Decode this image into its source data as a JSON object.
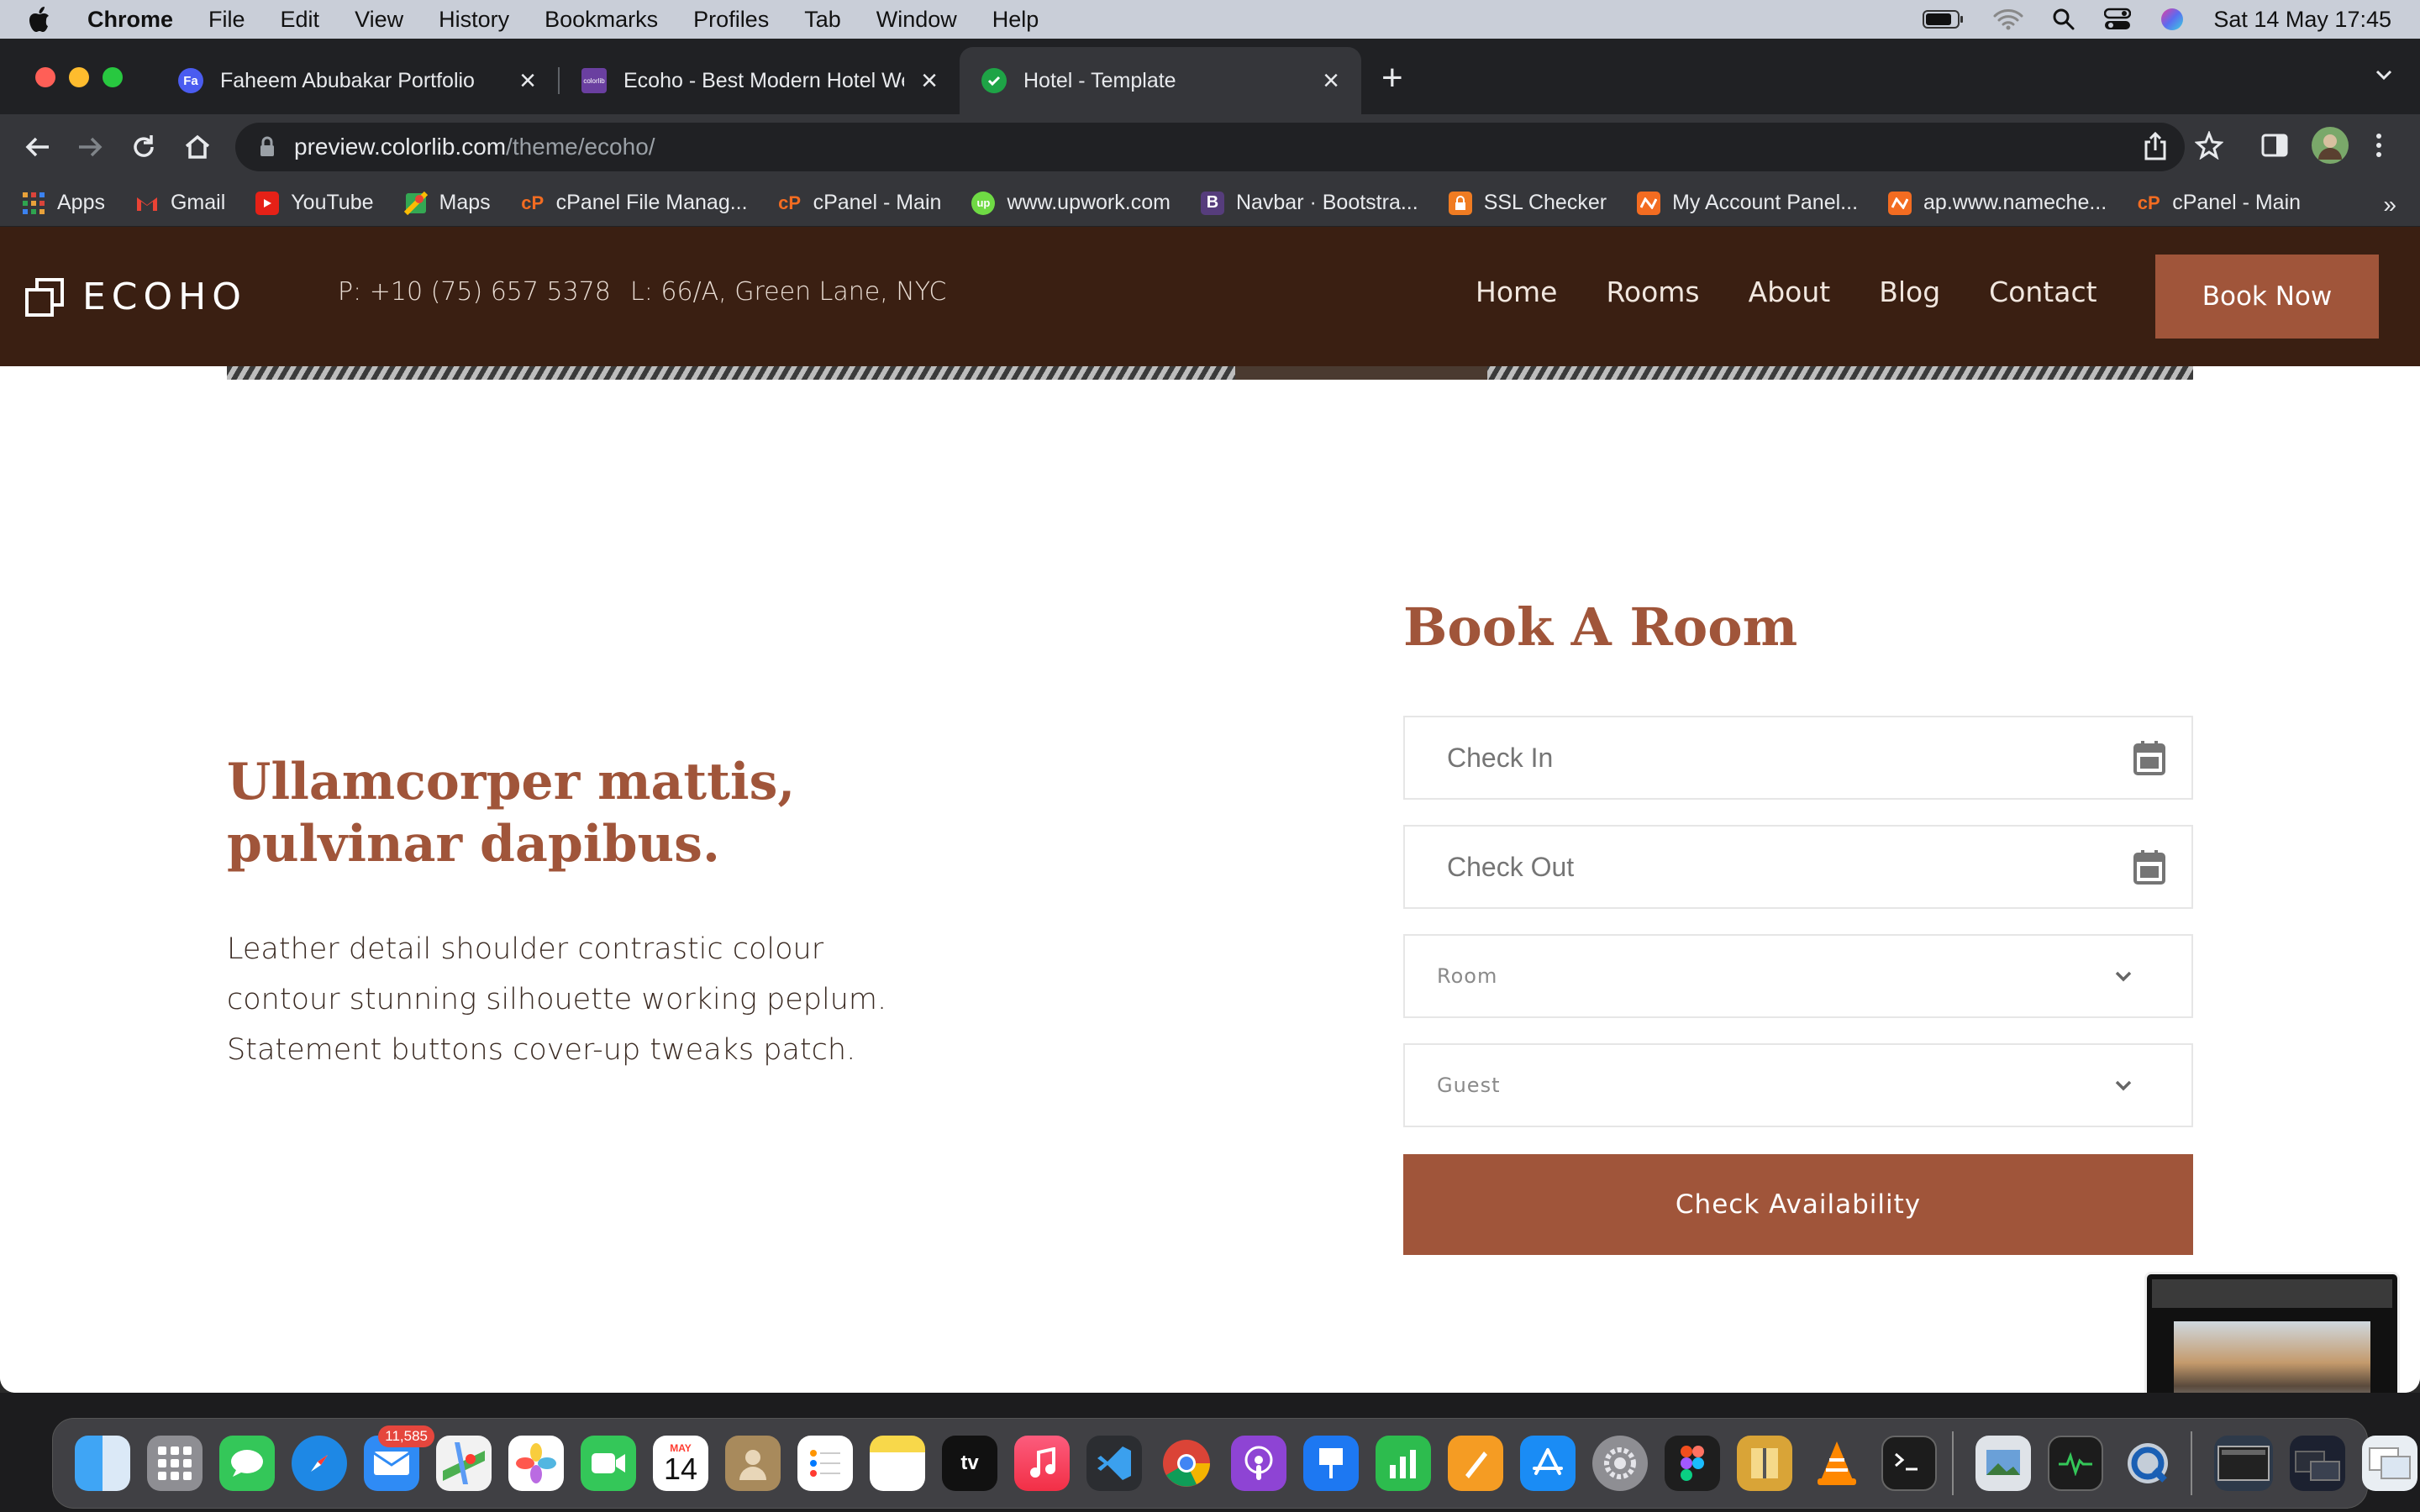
{
  "menubar": {
    "app": "Chrome",
    "items": [
      "File",
      "Edit",
      "View",
      "History",
      "Bookmarks",
      "Profiles",
      "Tab",
      "Window",
      "Help"
    ],
    "datetime": "Sat 14 May  17:45"
  },
  "tabs": [
    {
      "title": "Faheem Abubakar Portfolio",
      "favicon": "Fa"
    },
    {
      "title": "Ecoho - Best Modern Hotel We",
      "favicon": "colorlib"
    },
    {
      "title": "Hotel - Template",
      "favicon": "check"
    }
  ],
  "omnibox": {
    "host": "preview.colorlib.com",
    "path": "/theme/ecoho/"
  },
  "bookmarks": [
    {
      "label": "Apps",
      "icon": "apps-grid-icon"
    },
    {
      "label": "Gmail",
      "icon": "gmail-icon"
    },
    {
      "label": "YouTube",
      "icon": "youtube-icon"
    },
    {
      "label": "Maps",
      "icon": "maps-icon"
    },
    {
      "label": "cPanel File Manag...",
      "icon": "cpanel-icon"
    },
    {
      "label": "cPanel - Main",
      "icon": "cpanel-icon"
    },
    {
      "label": "www.upwork.com",
      "icon": "upwork-icon"
    },
    {
      "label": "Navbar · Bootstra...",
      "icon": "bootstrap-icon"
    },
    {
      "label": "SSL Checker",
      "icon": "lock-icon"
    },
    {
      "label": "My Account Panel...",
      "icon": "namecheap-icon"
    },
    {
      "label": "ap.www.nameche...",
      "icon": "namecheap-icon"
    },
    {
      "label": "cPanel - Main",
      "icon": "cpanel-icon"
    }
  ],
  "site": {
    "logo": "ECOHO",
    "phone": "P: +10 (75) 657 5378",
    "location": "L: 66/A, Green Lane, NYC",
    "nav": [
      "Home",
      "Rooms",
      "About",
      "Blog",
      "Contact"
    ],
    "book_now": "Book Now",
    "heading_line1": "Ullamcorper mattis,",
    "heading_line2": "pulvinar dapibus.",
    "paragraph_line1": "Leather detail shoulder contrastic colour",
    "paragraph_line2": "contour stunning silhouette working peplum.",
    "paragraph_line3": "Statement buttons cover-up tweaks patch."
  },
  "booking": {
    "title": "Book A Room",
    "check_in_placeholder": "Check In",
    "check_out_placeholder": "Check Out",
    "room_selected": "Room",
    "guest_selected": "Guest",
    "submit_label": "Check Availability"
  },
  "dock": {
    "mail_badge": "11,585",
    "calendar_month": "MAY",
    "calendar_day": "14",
    "tv_label": "tv"
  },
  "colors": {
    "accent": "#a0553a",
    "header_bg": "#3a1f12"
  }
}
